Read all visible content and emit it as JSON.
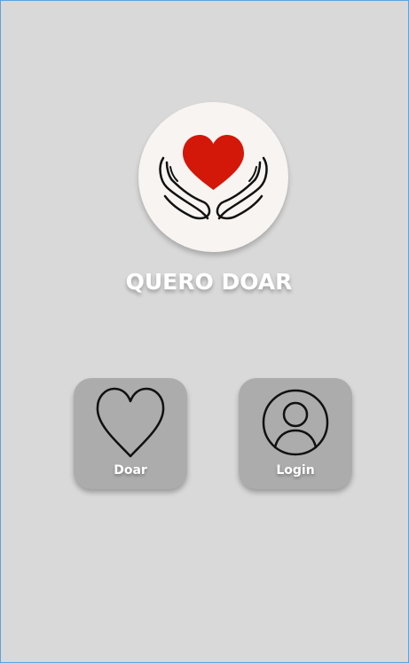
{
  "app": {
    "title": "QUERO DOAR",
    "logo_icon": "hands-holding-heart-icon"
  },
  "tiles": [
    {
      "label": "Doar",
      "icon": "heart-outline-icon"
    },
    {
      "label": "Login",
      "icon": "user-circle-icon"
    }
  ],
  "colors": {
    "background": "#d9d9d9",
    "logo_background": "#f8f4f1",
    "heart": "#d31709",
    "tile": "#acacac",
    "text": "#ffffff"
  }
}
